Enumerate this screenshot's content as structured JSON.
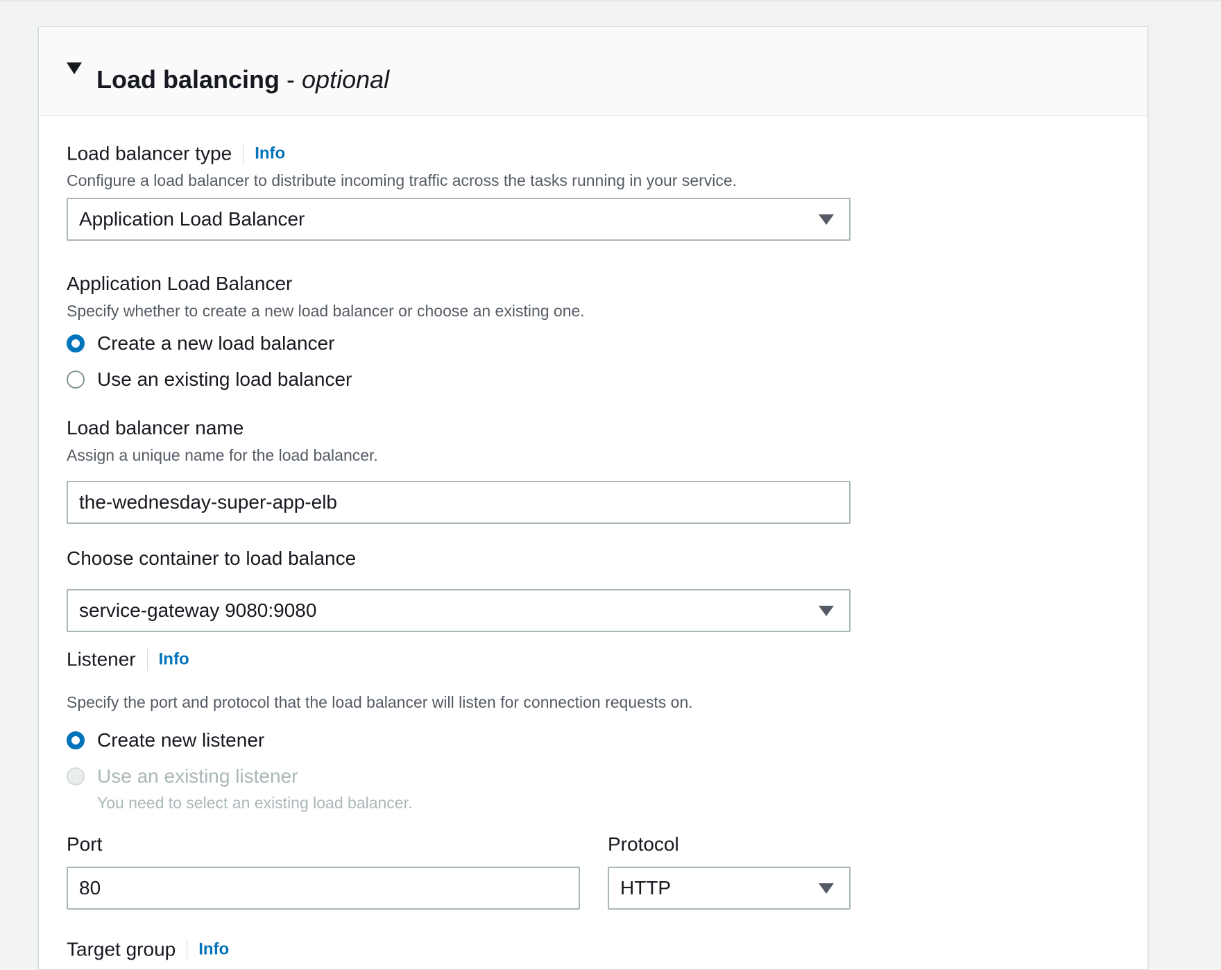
{
  "section": {
    "title": "Load balancing",
    "separator": " - ",
    "optional": "optional"
  },
  "lb_type": {
    "label": "Load balancer type",
    "info": "Info",
    "description": "Configure a load balancer to distribute incoming traffic across the tasks running in your service.",
    "selected": "Application Load Balancer"
  },
  "alb": {
    "label": "Application Load Balancer",
    "description": "Specify whether to create a new load balancer or choose an existing one.",
    "options": [
      {
        "label": "Create a new load balancer",
        "checked": true
      },
      {
        "label": "Use an existing load balancer",
        "checked": false
      }
    ]
  },
  "lb_name": {
    "label": "Load balancer name",
    "description": "Assign a unique name for the load balancer.",
    "value": "the-wednesday-super-app-elb"
  },
  "container": {
    "label": "Choose container to load balance",
    "selected": "service-gateway 9080:9080"
  },
  "listener": {
    "label": "Listener",
    "info": "Info",
    "description": "Specify the port and protocol that the load balancer will listen for connection requests on.",
    "options": [
      {
        "label": "Create new listener",
        "checked": true
      },
      {
        "label": "Use an existing listener",
        "checked": false,
        "disabled": true,
        "hint": "You need to select an existing load balancer."
      }
    ]
  },
  "port": {
    "label": "Port",
    "value": "80"
  },
  "protocol": {
    "label": "Protocol",
    "selected": "HTTP"
  },
  "target_group": {
    "label": "Target group",
    "info": "Info"
  },
  "colors": {
    "accent": "#0073bb",
    "text": "#16191f",
    "muted": "#545b64",
    "disabled": "#aab7b8",
    "border": "#aab7b8"
  }
}
